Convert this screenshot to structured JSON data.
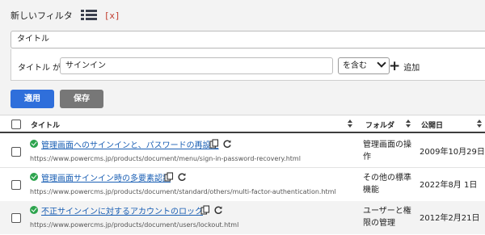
{
  "filter": {
    "title": "新しいフィルタ",
    "close_label": "[x]",
    "field": "タイトル",
    "condition_label": "タイトル が",
    "condition_value": "サインイン",
    "operator": "を含む",
    "add_label": "追加",
    "apply_label": "適用",
    "save_label": "保存"
  },
  "table": {
    "headers": {
      "title": "タイトル",
      "folder": "フォルダ",
      "date": "公開日"
    },
    "rows": [
      {
        "title": "管理画面へのサインインと、パスワードの再設定",
        "url": "https://www.powercms.jp/products/document/menu/sign-in-password-recovery.html",
        "folder": "管理画面の操作",
        "date": "2009年10月29日"
      },
      {
        "title": "管理画面サインイン時の多要素認証",
        "url": "https://www.powercms.jp/products/document/standard/others/multi-factor-authentication.html",
        "folder": "その他の標準機能",
        "date": "2022年8月 1日"
      },
      {
        "title": "不正サインインに対するアカウントのロック",
        "url": "https://www.powercms.jp/products/document/users/lockout.html",
        "folder": "ユーザーと権限の管理",
        "date": "2012年2月21日"
      }
    ]
  },
  "colors": {
    "accent": "#2f6fdb",
    "link": "#1a5fb4",
    "status_ok": "#2da44e",
    "close": "#c0392b"
  }
}
